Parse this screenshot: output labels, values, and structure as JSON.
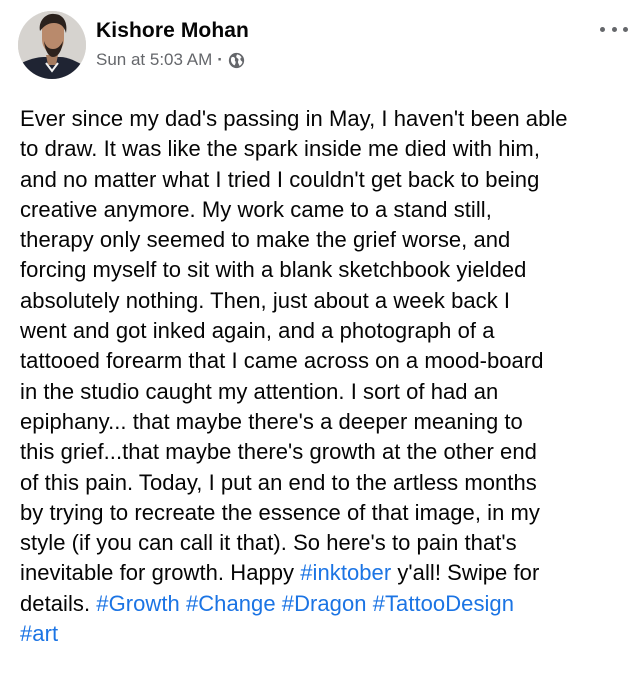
{
  "author": {
    "name": "Kishore Mohan",
    "timestamp": "Sun at 5:03 AM",
    "separator": "·",
    "privacy_icon": "globe-icon",
    "avatar_icon": "profile-photo"
  },
  "more_menu_icon": "more-options-icon",
  "post": {
    "lines": [
      "Ever since my dad's passing in May, I haven't been able",
      "to draw. It was like the spark inside me died with him,",
      "and no matter what I tried I couldn't get back to being",
      "creative anymore. My work came to a stand still,",
      "therapy only seemed to make the grief worse, and",
      "forcing myself to sit with a blank sketchbook yielded",
      "absolutely nothing. Then, just about a week back I",
      "went and got inked again, and a photograph of a",
      "tattooed forearm that I came across on a mood-board",
      "in the studio caught my attention. I sort of had an",
      "epiphany... that maybe there's a deeper meaning to",
      "this grief...that maybe there's growth at the other end",
      "of this pain. Today, I put an end to the artless months",
      "by trying to recreate the essence of that image, in my",
      "style (if you can call it that). So here's to pain that's"
    ],
    "line16_before": "inevitable for growth. Happy ",
    "hashtag_inktober": "#inktober",
    "line16_after": " y'all! Swipe for",
    "line17_before": "details. ",
    "hashtag_growth": "#Growth",
    "hashtag_change": "#Change",
    "hashtag_dragon": "#Dragon",
    "hashtag_tattoodesign": "#TattooDesign",
    "hashtag_art": "#art"
  },
  "colors": {
    "hashtag": "#1b74e4",
    "meta_text": "#65676b",
    "body_text": "#050505"
  }
}
